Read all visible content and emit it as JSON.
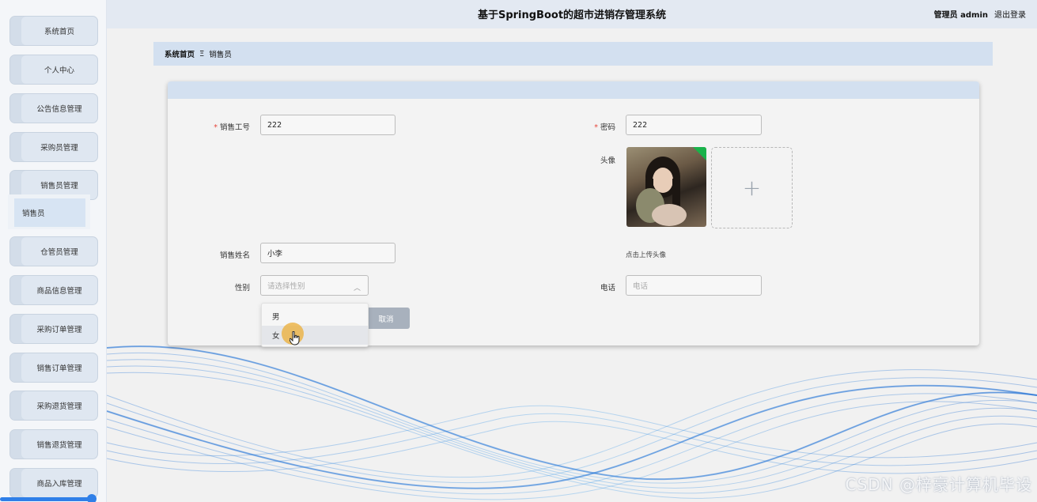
{
  "header": {
    "title": "基于SpringBoot的超市进销存管理系统",
    "user": "管理员 admin",
    "logout": "退出登录"
  },
  "sidebar": {
    "items": [
      {
        "label": "系统首页"
      },
      {
        "label": "个人中心"
      },
      {
        "label": "公告信息管理"
      },
      {
        "label": "采购员管理"
      },
      {
        "label": "销售员管理"
      },
      {
        "label": "仓管员管理"
      },
      {
        "label": "商品信息管理"
      },
      {
        "label": "采购订单管理"
      },
      {
        "label": "销售订单管理"
      },
      {
        "label": "采购退货管理"
      },
      {
        "label": "销售退货管理"
      },
      {
        "label": "商品入库管理"
      }
    ],
    "active_sub": "销售员"
  },
  "breadcrumb": {
    "home": "系统首页",
    "sep": "Ξ",
    "current": "销售员"
  },
  "form": {
    "required_mark": "*",
    "job_no_label": "销售工号",
    "job_no_value": "222",
    "password_label": "密码",
    "password_value": "222",
    "avatar_label": "头像",
    "upload_plus": "+",
    "upload_hint": "点击上传头像",
    "name_label": "销售姓名",
    "name_value": "小李",
    "gender_label": "性别",
    "gender_placeholder": "请选择性别",
    "gender_chevron": "︿",
    "phone_label": "电话",
    "phone_placeholder": "电话",
    "cancel_button": "取消"
  },
  "dropdown": {
    "options": [
      "男",
      "女"
    ],
    "hovered": "女"
  },
  "watermark": "CSDN @梓豪计算机毕设",
  "colors": {
    "accent": "#2f7fe8",
    "header_bg": "#e3e9f2",
    "breadcrumb_bg": "#d3e0f0",
    "required": "#e6453a"
  }
}
